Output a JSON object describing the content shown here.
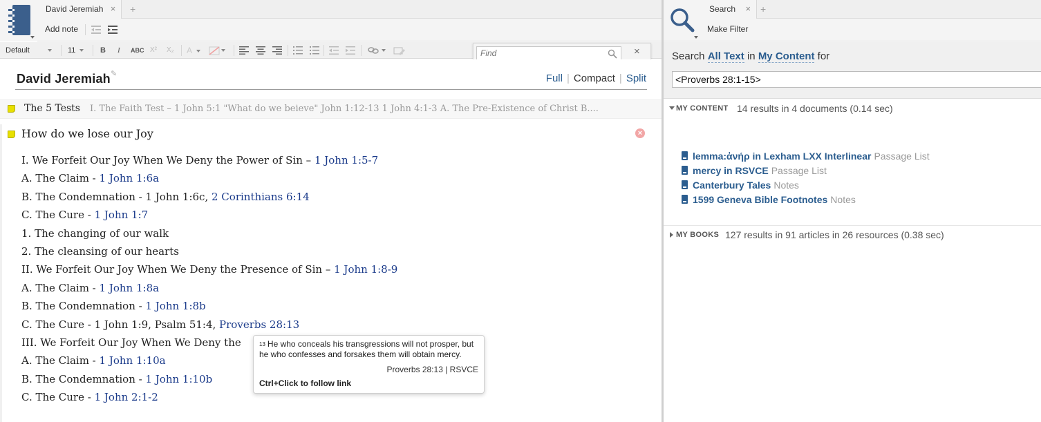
{
  "colors": {
    "link": "#2b5d8f",
    "scripture_ref": "#1a3a8a",
    "note_flag": "#e8e000",
    "muted": "#999999"
  },
  "left_panel": {
    "tab_label": "David Jeremiah",
    "toolbar": {
      "add_note": "Add note"
    },
    "format_bar": {
      "font": "Default",
      "size": "11",
      "bold": "B",
      "italic": "I",
      "smallcaps": "ABC",
      "superscript": "X²",
      "subscript": "X₂",
      "text_color": "A"
    },
    "find": {
      "placeholder": "Find"
    },
    "document": {
      "title": "David Jeremiah",
      "view_modes": [
        "Full",
        "Compact",
        "Split"
      ],
      "notes": [
        {
          "title": "The 5 Tests",
          "preview": "I. The Faith Test – 1 John 5:1 \"What do we beieve\" John 1:12-13 1 John 4:1-3 A. The Pre-Existence of Christ B...."
        },
        {
          "title": "How do we lose our Joy",
          "lines": [
            {
              "text": "I. We Forfeit Our Joy When We Deny the Power of Sin – ",
              "ref": "1 John 1:5-7"
            },
            {
              "text": "A. The Claim   - ",
              "ref": "1 John 1:6a"
            },
            {
              "text": "B. The Condemnation  - 1 John 1:6c, ",
              "ref": "2 Corinthians 6:14"
            },
            {
              "text": "C. The Cure  - ",
              "ref": "1 John 1:7"
            },
            {
              "text": "1. The changing of our walk",
              "ref": ""
            },
            {
              "text": "2. The cleansing of our hearts",
              "ref": ""
            },
            {
              "text": "II. We Forfeit Our Joy When We Deny the Presence of Sin – ",
              "ref": "1 John 1:8-9"
            },
            {
              "text": "A. The Claim - ",
              "ref": "1 John 1:8a"
            },
            {
              "text": "B. The Condemnation - ",
              "ref": "1 John 1:8b"
            },
            {
              "text": "C. The Cure - 1 John 1:9, Psalm 51:4, ",
              "ref": "Proverbs 28:13"
            },
            {
              "text": "III. We Forfeit Our Joy When We Deny the",
              "ref": ""
            },
            {
              "text": "A. The Claim - ",
              "ref": "1 John 1:10a"
            },
            {
              "text": "B. The Condemnation - ",
              "ref": "1 John 1:10b"
            },
            {
              "text": "C. The Cure - ",
              "ref": "1 John 2:1-2"
            }
          ]
        }
      ]
    },
    "tooltip": {
      "verse_num": "13",
      "verse_text": "He who conceals his transgressions will not prosper, but he who confesses and forsakes them will obtain mercy.",
      "citation": "Proverbs 28:13 | RSVCE",
      "hint": "Ctrl+Click to follow link"
    }
  },
  "right_panel": {
    "tab_label": "Search",
    "toolbar": {
      "make_filter": "Make Filter"
    },
    "search": {
      "prefix": "Search",
      "scope": "All Text",
      "in_word": "in",
      "target": "My Content",
      "for_word": "for",
      "query": "<Proverbs 28:1-15>"
    },
    "my_content": {
      "label": "MY CONTENT",
      "summary": "14 results in 4 documents (0.14 sec)",
      "results": [
        {
          "title": "lemma:ἀνήρ in Lexham LXX Interlinear",
          "type": "Passage List"
        },
        {
          "title": "mercy in RSVCE",
          "type": "Passage List"
        },
        {
          "title": "Canterbury Tales",
          "type": "Notes"
        },
        {
          "title": "1599 Geneva Bible Footnotes",
          "type": "Notes"
        }
      ]
    },
    "my_books": {
      "label": "MY BOOKS",
      "summary": "127 results in 91 articles in 26 resources (0.38 sec)"
    }
  }
}
